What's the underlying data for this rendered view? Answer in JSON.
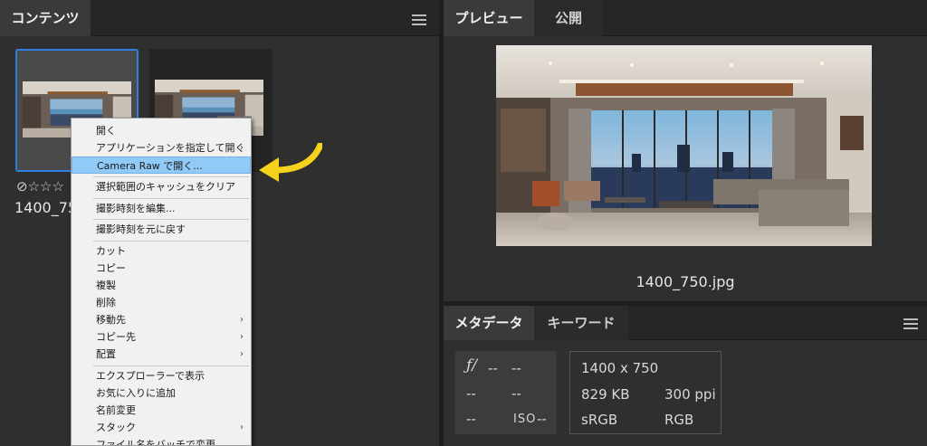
{
  "left": {
    "tab_contents": "コンテンツ",
    "thumbnail": {
      "status": "⊘☆☆☆",
      "filename_truncated": "1400_75"
    }
  },
  "context_menu": {
    "items": [
      {
        "label": "開く",
        "submenu": false,
        "highlight": false
      },
      {
        "label": "アプリケーションを指定して開く",
        "submenu": true,
        "highlight": false
      },
      {
        "label": "Camera Raw で開く...",
        "submenu": false,
        "highlight": true
      },
      {
        "label": "選択範囲のキャッシュをクリア",
        "submenu": false,
        "highlight": false
      },
      {
        "label": "撮影時刻を編集...",
        "submenu": false,
        "highlight": false
      },
      {
        "label": "撮影時刻を元に戻す",
        "submenu": false,
        "highlight": false
      },
      {
        "label": "カット",
        "submenu": false,
        "highlight": false
      },
      {
        "label": "コピー",
        "submenu": false,
        "highlight": false
      },
      {
        "label": "複製",
        "submenu": false,
        "highlight": false
      },
      {
        "label": "削除",
        "submenu": false,
        "highlight": false
      },
      {
        "label": "移動先",
        "submenu": true,
        "highlight": false
      },
      {
        "label": "コピー先",
        "submenu": true,
        "highlight": false
      },
      {
        "label": "配置",
        "submenu": true,
        "highlight": false
      },
      {
        "label": "エクスプローラーで表示",
        "submenu": false,
        "highlight": false
      },
      {
        "label": "お気に入りに追加",
        "submenu": false,
        "highlight": false
      },
      {
        "label": "名前変更",
        "submenu": false,
        "highlight": false
      },
      {
        "label": "スタック",
        "submenu": true,
        "highlight": false
      },
      {
        "label": "ファイル名をバッチで変更",
        "submenu": false,
        "highlight": false
      }
    ],
    "submenu_arrow": "›"
  },
  "preview": {
    "tab_preview": "プレビュー",
    "tab_publish": "公開",
    "filename": "1400_750.jpg"
  },
  "metadata": {
    "tab_metadata": "メタデータ",
    "tab_keywords": "キーワード",
    "fnumber_symbol": "ƒ/",
    "fnumber": "--",
    "shutter": "--",
    "exposure_comp": "--",
    "focal": "--",
    "metering": "--",
    "iso_label": "ISO",
    "iso": "--",
    "dimensions": "1400 x 750",
    "file_size": "829 KB",
    "resolution": "300 ppi",
    "color_profile": "sRGB",
    "color_mode": "RGB"
  },
  "colors": {
    "selection_border": "#2f7fe0",
    "menu_highlight": "#91c9f7",
    "arrow_yellow": "#f5d21b",
    "panel_bg": "#2f2f2f"
  }
}
